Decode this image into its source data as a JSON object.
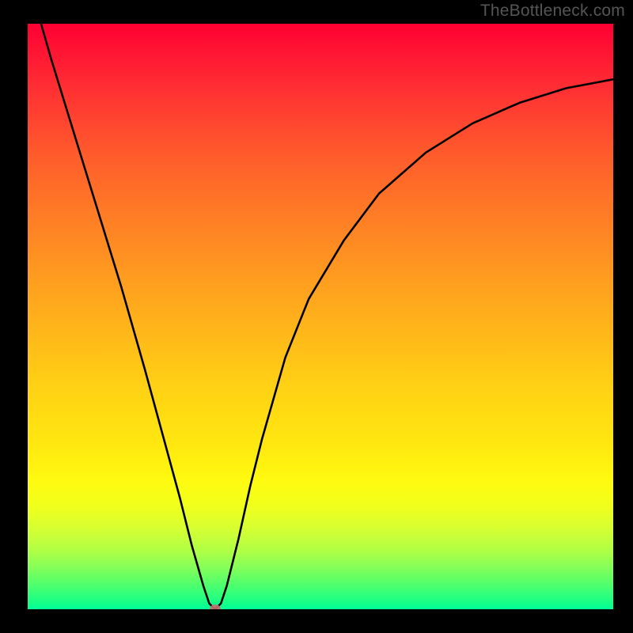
{
  "watermark": "TheBottleneck.com",
  "chart_data": {
    "type": "line",
    "title": "",
    "xlabel": "",
    "ylabel": "",
    "xlim": [
      0,
      100
    ],
    "ylim": [
      0,
      100
    ],
    "grid": false,
    "legend": false,
    "series": [
      {
        "name": "bottleneck-curve",
        "x": [
          0,
          4,
          8,
          12,
          16,
          20,
          23,
          26,
          28,
          30,
          31,
          32,
          33,
          34,
          36,
          38,
          40,
          44,
          48,
          54,
          60,
          68,
          76,
          84,
          92,
          100
        ],
        "y": [
          108,
          94,
          81,
          68,
          55,
          41,
          30,
          19,
          11,
          4,
          1,
          0,
          1,
          4,
          12,
          21,
          29,
          43,
          53,
          63,
          71,
          78,
          83,
          86.5,
          89,
          90.5
        ]
      }
    ],
    "minimum_marker": {
      "x": 32,
      "y": 0
    },
    "background_gradient": {
      "top": "#ff0033",
      "mid": "#ffe010",
      "bottom": "#00ff99"
    }
  }
}
